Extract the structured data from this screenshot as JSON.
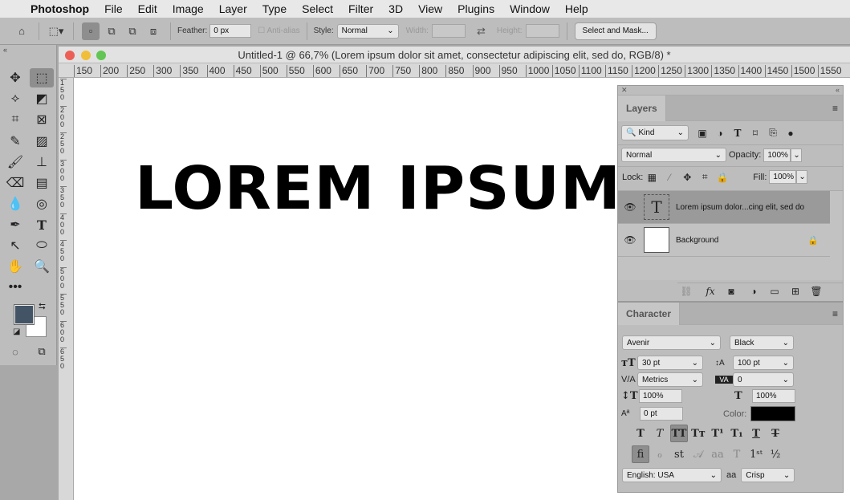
{
  "menubar": {
    "apple": "",
    "app": "Photoshop",
    "items": [
      "File",
      "Edit",
      "Image",
      "Layer",
      "Type",
      "Select",
      "Filter",
      "3D",
      "View",
      "Plugins",
      "Window",
      "Help"
    ]
  },
  "options": {
    "feather_label": "Feather:",
    "feather_value": "0 px",
    "anti_alias": "Anti-alias",
    "style_label": "Style:",
    "style_value": "Normal",
    "width_label": "Width:",
    "height_label": "Height:",
    "select_mask": "Select and Mask..."
  },
  "document": {
    "title": "Untitled-1 @ 66,7% (Lorem ipsum dolor sit amet, consectetur adipiscing elit, sed do, RGB/8) *",
    "canvas_text": "LOREM IPSUM",
    "h_ruler": [
      150,
      200,
      250,
      300,
      350,
      400,
      450,
      500,
      550,
      600,
      650,
      700,
      750,
      800,
      850,
      900,
      950,
      1000,
      1050,
      1100,
      1150,
      1200,
      1250,
      1300,
      1350,
      1400,
      1450,
      1500,
      1550
    ],
    "v_ruler": [
      150,
      200,
      250,
      300,
      350,
      400,
      450,
      500,
      550,
      600,
      650
    ]
  },
  "toolbar": {
    "foreground_color": "#435466",
    "background_color": "#ffffff"
  },
  "layers": {
    "tab": "Layers",
    "filter": "Kind",
    "blend_mode": "Normal",
    "opacity_label": "Opacity:",
    "opacity": "100%",
    "lock_label": "Lock:",
    "fill_label": "Fill:",
    "fill": "100%",
    "items": [
      {
        "name": "Lorem ipsum dolor...cing elit, sed do",
        "type": "text",
        "selected": true
      },
      {
        "name": "Background",
        "type": "image",
        "locked": true
      }
    ]
  },
  "character": {
    "tab": "Character",
    "font_family": "Avenir",
    "font_style": "Black",
    "size": "30 pt",
    "leading": "100 pt",
    "kerning": "Metrics",
    "tracking": "0",
    "vscale": "100%",
    "hscale": "100%",
    "baseline": "0 pt",
    "color_label": "Color:",
    "color": "#000000",
    "language": "English: USA",
    "aa_label": "aa",
    "antialias": "Crisp"
  }
}
